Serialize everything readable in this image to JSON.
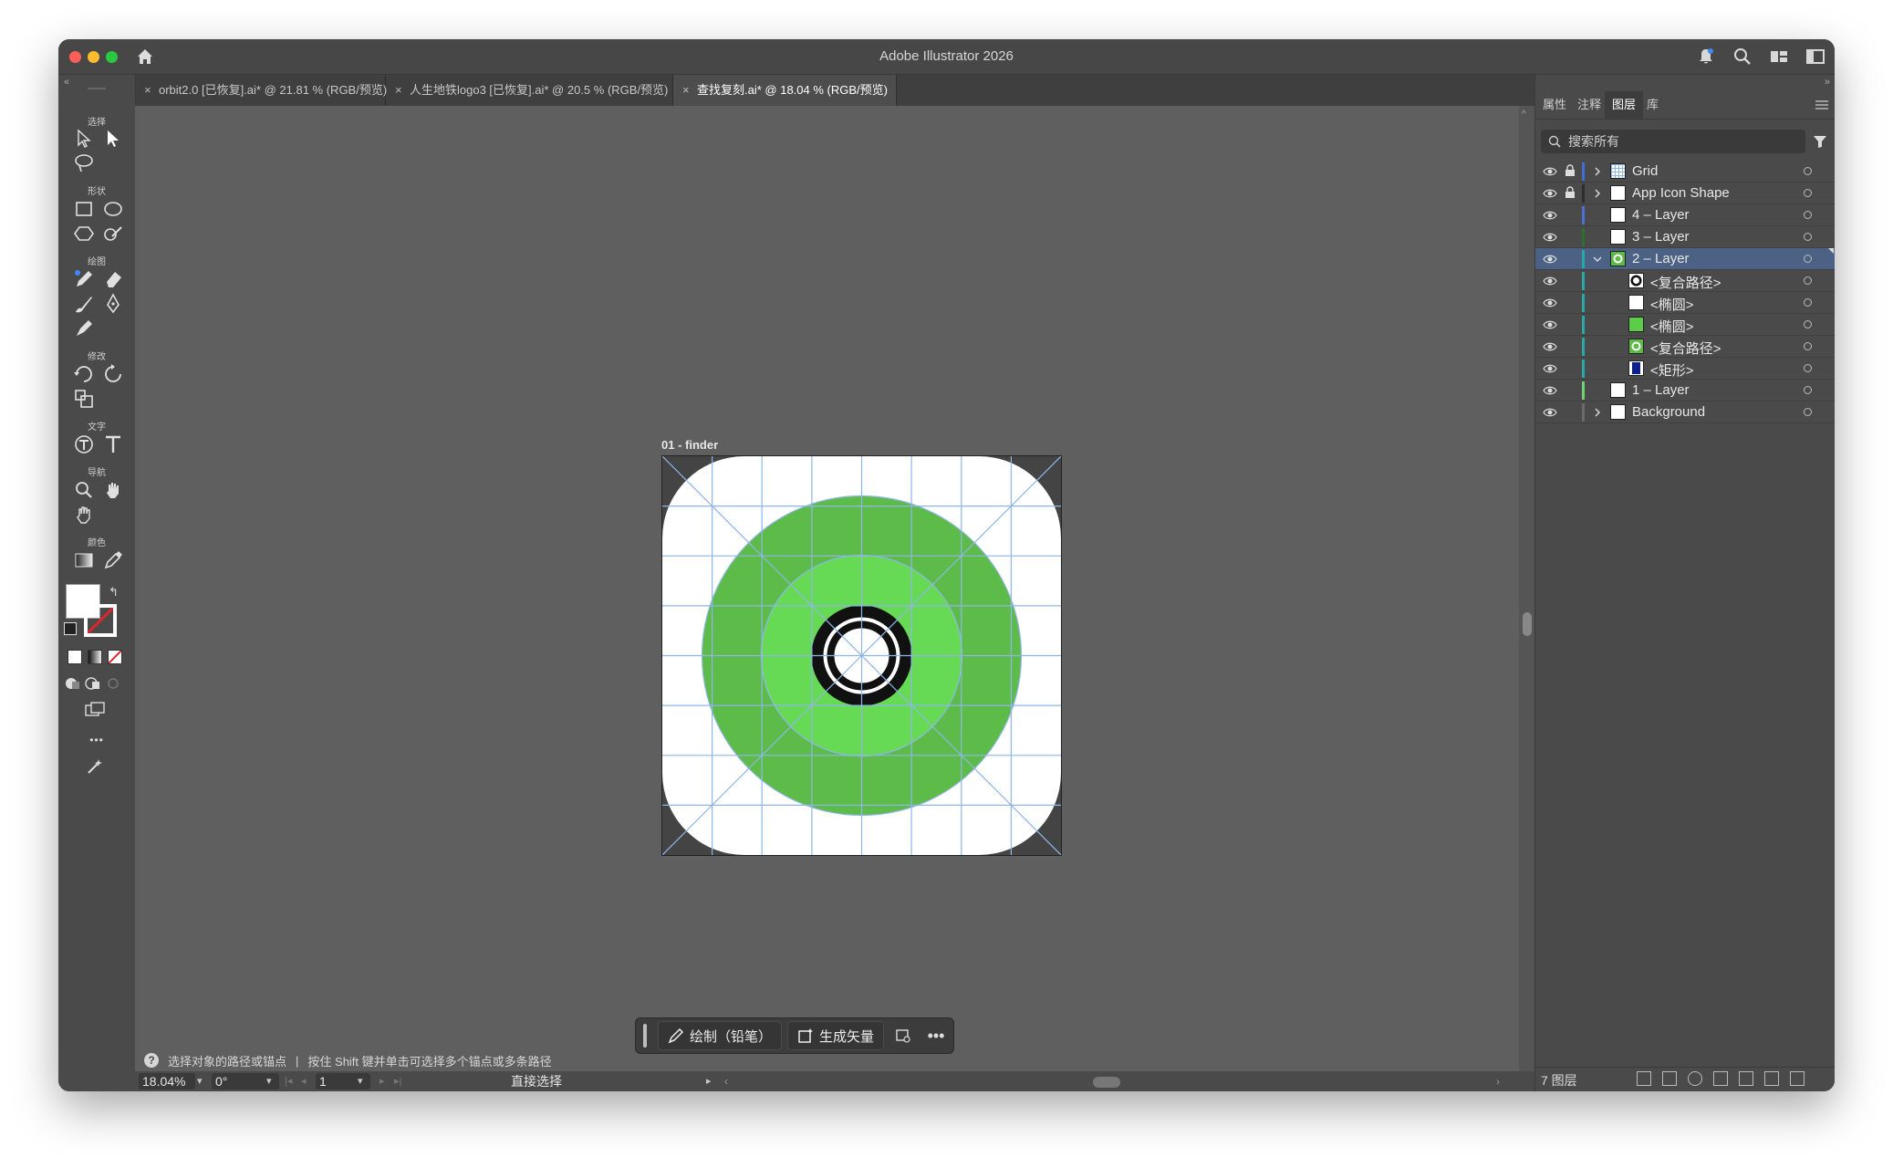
{
  "window": {
    "title": "Adobe Illustrator 2026"
  },
  "tabs": [
    {
      "label": "orbit2.0 [已恢复].ai* @ 21.81 % (RGB/预览)",
      "active": false
    },
    {
      "label": "人生地铁logo3 [已恢复].ai* @ 20.5 % (RGB/预览)",
      "active": false
    },
    {
      "label": "查找复刻.ai* @ 18.04 % (RGB/预览)",
      "active": true
    }
  ],
  "tab_close_glyph": "×",
  "toolbar": {
    "groups": [
      "选择",
      "形状",
      "绘图",
      "修改",
      "文字",
      "导航",
      "颜色"
    ],
    "more_glyph": "•••"
  },
  "canvas": {
    "artboard_label": "01 - finder",
    "icon_colors": {
      "outer": "#5dbb4a",
      "inner": "#66d955",
      "ring": "#111111",
      "grid": "#8fb6e6",
      "background": "#ffffff"
    }
  },
  "context_bar": {
    "draw_label": "绘制（铅笔）",
    "generate_label": "生成矢量",
    "more_glyph": "•••"
  },
  "hint": {
    "text": "选择对象的路径或锚点",
    "separator": "|",
    "text2": "按住 Shift 键并单击可选择多个锚点或多条路径"
  },
  "status": {
    "zoom": "18.04%",
    "rotation": "0°",
    "artboard_num": "1",
    "tool_name": "直接选择"
  },
  "panel": {
    "tabs": [
      "属性",
      "注释",
      "图层",
      "库"
    ],
    "active_tab": "图层",
    "search_placeholder": "搜索所有",
    "layers": [
      {
        "name": "Grid",
        "locked": true,
        "expandable": true,
        "expanded": false,
        "indent": 0,
        "thumb": "grid",
        "bar": "#3d6fd6"
      },
      {
        "name": "App Icon Shape",
        "locked": true,
        "expandable": true,
        "expanded": false,
        "indent": 0,
        "thumb": "white",
        "bar": "#2d2d2d"
      },
      {
        "name": "4 – Layer",
        "locked": false,
        "expandable": false,
        "expanded": false,
        "indent": 0,
        "thumb": "white",
        "bar": "#4d6fd6"
      },
      {
        "name": "3 – Layer",
        "locked": false,
        "expandable": false,
        "expanded": false,
        "indent": 0,
        "thumb": "white",
        "bar": "#2e6e2e"
      },
      {
        "name": "2 – Layer",
        "locked": false,
        "expandable": true,
        "expanded": true,
        "indent": 0,
        "thumb": "green-ring",
        "bar": "#2aa8a8",
        "selected": true
      },
      {
        "name": "<复合路径>",
        "locked": false,
        "expandable": false,
        "expanded": false,
        "indent": 1,
        "thumb": "black-ring",
        "bar": "#2aa8a8"
      },
      {
        "name": "<椭圆>",
        "locked": false,
        "expandable": false,
        "expanded": false,
        "indent": 1,
        "thumb": "white",
        "bar": "#2aa8a8"
      },
      {
        "name": "<椭圆>",
        "locked": false,
        "expandable": false,
        "expanded": false,
        "indent": 1,
        "thumb": "green",
        "bar": "#2aa8a8"
      },
      {
        "name": "<复合路径>",
        "locked": false,
        "expandable": false,
        "expanded": false,
        "indent": 1,
        "thumb": "green-ring2",
        "bar": "#2aa8a8"
      },
      {
        "name": "<矩形>",
        "locked": false,
        "expandable": false,
        "expanded": false,
        "indent": 1,
        "thumb": "navy",
        "bar": "#2aa8a8"
      },
      {
        "name": "1 – Layer",
        "locked": false,
        "expandable": false,
        "expanded": false,
        "indent": 0,
        "thumb": "white",
        "bar": "#6fd36f"
      },
      {
        "name": "Background",
        "locked": false,
        "expandable": true,
        "expanded": false,
        "indent": 0,
        "thumb": "white",
        "bar": "#6a6a6a"
      }
    ],
    "footer_count": "7 图层"
  }
}
